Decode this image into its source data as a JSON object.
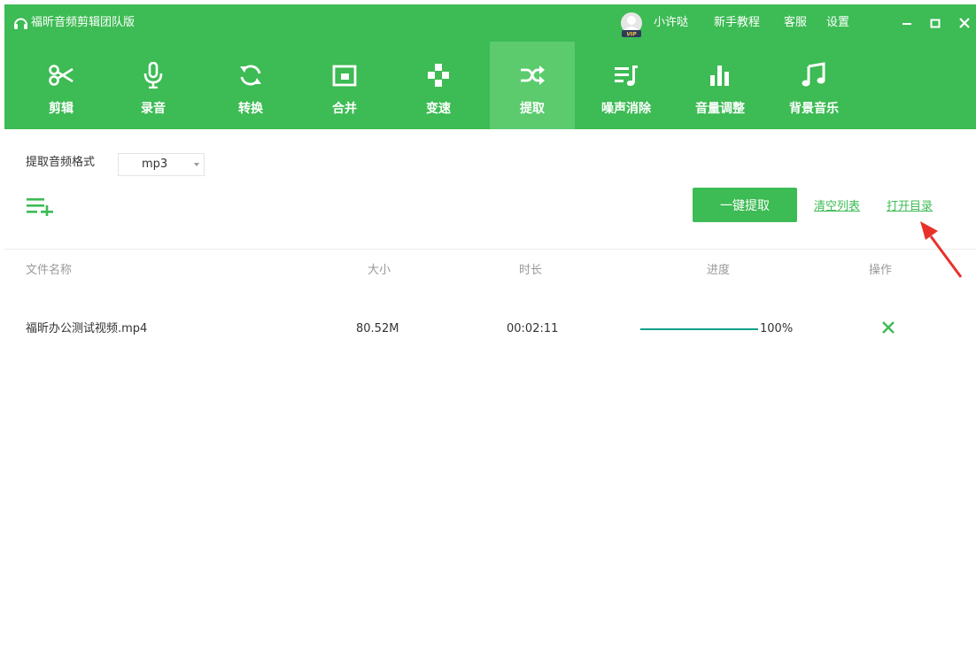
{
  "titlebar": {
    "app_title": "福昕音频剪辑团队版",
    "username": "小许哒",
    "tutorial": "新手教程",
    "support": "客服",
    "settings": "设置",
    "vip_badge": "VIP"
  },
  "toolbar": {
    "items": [
      {
        "label": "剪辑",
        "icon": "scissors-icon"
      },
      {
        "label": "录音",
        "icon": "microphone-icon"
      },
      {
        "label": "转换",
        "icon": "convert-icon"
      },
      {
        "label": "合并",
        "icon": "merge-icon"
      },
      {
        "label": "变速",
        "icon": "speed-icon"
      },
      {
        "label": "提取",
        "icon": "extract-shuffle-icon"
      },
      {
        "label": "噪声消除",
        "icon": "noise-removal-icon"
      },
      {
        "label": "音量调整",
        "icon": "volume-bars-icon"
      },
      {
        "label": "背景音乐",
        "icon": "music-note-icon"
      }
    ],
    "active_index": 5
  },
  "format": {
    "label": "提取音频格式",
    "value": "mp3"
  },
  "actions": {
    "extract_button": "一键提取",
    "clear_list": "清空列表",
    "open_folder": "打开目录"
  },
  "table": {
    "headers": {
      "name": "文件名称",
      "size": "大小",
      "duration": "时长",
      "progress": "进度",
      "action": "操作"
    },
    "rows": [
      {
        "name": "福昕办公测试视频.mp4",
        "size": "80.52M",
        "duration": "00:02:11",
        "progress": 100,
        "progress_label": "100%"
      }
    ]
  },
  "colors": {
    "brand_green": "#3dbb54",
    "active_tab": "#5bcb6d",
    "progress": "#11a08a",
    "annotation_arrow": "#e8312b"
  }
}
